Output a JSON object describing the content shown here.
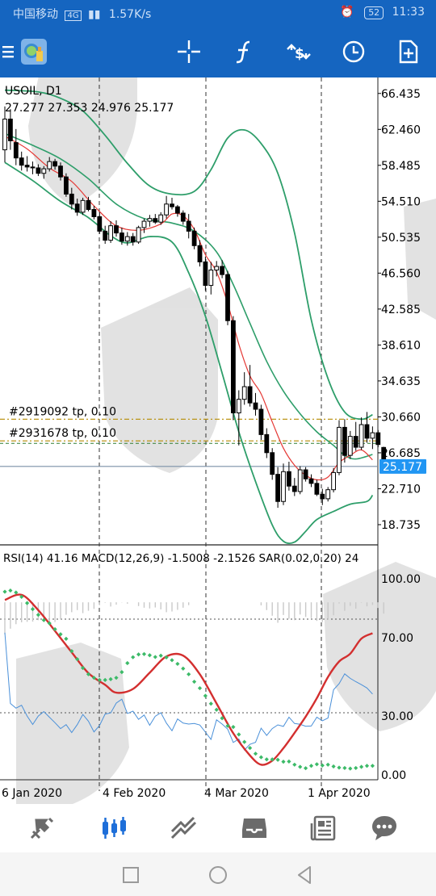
{
  "status_bar": {
    "carrier": "中国移动",
    "network": "4G",
    "speed": "1.57K/s",
    "battery": "52",
    "time": "11:33"
  },
  "toolbar": {
    "icons": [
      "menu-icon",
      "app-logo-icon",
      "crosshair-icon",
      "indicators-icon",
      "trade-icon",
      "timeframe-icon",
      "new-order-icon"
    ]
  },
  "chart": {
    "symbol_line": "USOIL, D1",
    "ohlc_line": "27.277 27.353 24.976 25.177",
    "current_price": "25.177",
    "price_labels": [
      "66.435",
      "62.460",
      "58.485",
      "54.510",
      "50.535",
      "46.560",
      "42.585",
      "38.610",
      "34.635",
      "30.660",
      "26.685",
      "22.710",
      "18.735"
    ],
    "order_lines": [
      {
        "label": "#2919092 tp, 0.10",
        "price": 30.4
      },
      {
        "label": "#2931678 tp, 0.10",
        "price": 28.0
      }
    ],
    "indicator_header": "RSI(14) 41.16 MACD(12,26,9) -1.5008 -2.1526 SAR(0.02,0.20) 24",
    "indicator_labels": [
      "100.00",
      "70.00",
      "30.00",
      "0.00"
    ],
    "date_labels": [
      "6 Jan 2020",
      "4 Feb 2020",
      "4 Mar 2020",
      "1 Apr 2020"
    ],
    "colors": {
      "bull_candle": "#ffffff",
      "bear_candle": "#000000",
      "bollinger": "#2e9e6a",
      "moving_average": "#e53935",
      "rsi": "#4a90d9",
      "macd_signal": "#d32f2f",
      "sar": "#3cba68",
      "current_price_tag": "#2196f3",
      "order_line": "#b58a00",
      "order_line_2": "#2e7d32"
    }
  },
  "chart_data": {
    "type": "candlestick",
    "symbol": "USOIL",
    "timeframe": "D1",
    "ylim": [
      16.5,
      68.2
    ],
    "date_ticks": [
      "6 Jan 2020",
      "4 Feb 2020",
      "4 Mar 2020",
      "1 Apr 2020"
    ],
    "candles": [
      {
        "o": 60.2,
        "h": 65.0,
        "l": 58.8,
        "c": 63.6
      },
      {
        "o": 63.6,
        "h": 64.7,
        "l": 60.2,
        "c": 61.2
      },
      {
        "o": 61.0,
        "h": 62.5,
        "l": 58.5,
        "c": 59.3
      },
      {
        "o": 59.3,
        "h": 60.0,
        "l": 57.9,
        "c": 58.5
      },
      {
        "o": 58.5,
        "h": 59.5,
        "l": 57.8,
        "c": 58.3
      },
      {
        "o": 58.3,
        "h": 58.9,
        "l": 57.5,
        "c": 58.2
      },
      {
        "o": 58.2,
        "h": 58.6,
        "l": 57.3,
        "c": 57.6
      },
      {
        "o": 57.6,
        "h": 58.4,
        "l": 57.0,
        "c": 58.1
      },
      {
        "o": 58.1,
        "h": 59.4,
        "l": 57.8,
        "c": 58.9
      },
      {
        "o": 58.9,
        "h": 59.2,
        "l": 58.0,
        "c": 58.4
      },
      {
        "o": 58.4,
        "h": 58.8,
        "l": 56.8,
        "c": 57.2
      },
      {
        "o": 57.2,
        "h": 57.6,
        "l": 55.0,
        "c": 55.3
      },
      {
        "o": 55.3,
        "h": 56.0,
        "l": 53.6,
        "c": 54.2
      },
      {
        "o": 54.2,
        "h": 54.8,
        "l": 52.9,
        "c": 53.3
      },
      {
        "o": 53.3,
        "h": 54.9,
        "l": 53.0,
        "c": 54.6
      },
      {
        "o": 54.6,
        "h": 55.0,
        "l": 53.4,
        "c": 53.6
      },
      {
        "o": 53.6,
        "h": 54.0,
        "l": 52.5,
        "c": 52.8
      },
      {
        "o": 52.8,
        "h": 53.3,
        "l": 50.9,
        "c": 51.2
      },
      {
        "o": 51.2,
        "h": 51.8,
        "l": 49.8,
        "c": 50.2
      },
      {
        "o": 50.2,
        "h": 52.3,
        "l": 49.9,
        "c": 51.8
      },
      {
        "o": 51.8,
        "h": 52.4,
        "l": 50.6,
        "c": 51.0
      },
      {
        "o": 51.0,
        "h": 51.6,
        "l": 49.7,
        "c": 50.1
      },
      {
        "o": 50.1,
        "h": 51.1,
        "l": 49.6,
        "c": 50.6
      },
      {
        "o": 50.6,
        "h": 51.0,
        "l": 49.6,
        "c": 50.0
      },
      {
        "o": 50.0,
        "h": 51.8,
        "l": 49.8,
        "c": 51.6
      },
      {
        "o": 51.6,
        "h": 52.6,
        "l": 51.0,
        "c": 52.3
      },
      {
        "o": 52.3,
        "h": 53.0,
        "l": 51.7,
        "c": 52.6
      },
      {
        "o": 52.6,
        "h": 53.1,
        "l": 52.0,
        "c": 52.2
      },
      {
        "o": 52.2,
        "h": 53.3,
        "l": 51.9,
        "c": 53.0
      },
      {
        "o": 53.0,
        "h": 55.1,
        "l": 52.6,
        "c": 54.2
      },
      {
        "o": 54.2,
        "h": 54.9,
        "l": 53.6,
        "c": 53.9
      },
      {
        "o": 53.9,
        "h": 54.1,
        "l": 52.8,
        "c": 53.2
      },
      {
        "o": 53.2,
        "h": 53.5,
        "l": 51.9,
        "c": 52.3
      },
      {
        "o": 52.3,
        "h": 53.1,
        "l": 50.4,
        "c": 51.2
      },
      {
        "o": 51.2,
        "h": 51.6,
        "l": 49.2,
        "c": 49.6
      },
      {
        "o": 49.6,
        "h": 50.2,
        "l": 47.3,
        "c": 47.8
      },
      {
        "o": 47.8,
        "h": 48.4,
        "l": 44.6,
        "c": 45.2
      },
      {
        "o": 45.2,
        "h": 47.8,
        "l": 44.2,
        "c": 46.9
      },
      {
        "o": 46.9,
        "h": 47.9,
        "l": 46.2,
        "c": 47.3
      },
      {
        "o": 47.3,
        "h": 48.0,
        "l": 46.0,
        "c": 46.4
      },
      {
        "o": 46.4,
        "h": 46.8,
        "l": 40.8,
        "c": 41.3
      },
      {
        "o": 41.3,
        "h": 41.8,
        "l": 30.3,
        "c": 31.1
      },
      {
        "o": 31.1,
        "h": 33.6,
        "l": 27.5,
        "c": 32.6
      },
      {
        "o": 32.6,
        "h": 35.6,
        "l": 32.0,
        "c": 34.0
      },
      {
        "o": 34.0,
        "h": 36.4,
        "l": 31.8,
        "c": 32.2
      },
      {
        "o": 32.2,
        "h": 33.3,
        "l": 30.8,
        "c": 31.5
      },
      {
        "o": 31.5,
        "h": 32.0,
        "l": 28.1,
        "c": 28.7
      },
      {
        "o": 28.7,
        "h": 29.4,
        "l": 26.1,
        "c": 26.7
      },
      {
        "o": 26.7,
        "h": 27.2,
        "l": 23.7,
        "c": 24.3
      },
      {
        "o": 24.3,
        "h": 25.1,
        "l": 20.6,
        "c": 21.3
      },
      {
        "o": 21.3,
        "h": 25.5,
        "l": 20.9,
        "c": 24.6
      },
      {
        "o": 24.6,
        "h": 25.7,
        "l": 22.5,
        "c": 23.0
      },
      {
        "o": 23.0,
        "h": 23.9,
        "l": 21.9,
        "c": 22.4
      },
      {
        "o": 22.4,
        "h": 25.2,
        "l": 22.1,
        "c": 24.8
      },
      {
        "o": 24.8,
        "h": 25.1,
        "l": 23.5,
        "c": 23.8
      },
      {
        "o": 23.8,
        "h": 24.3,
        "l": 22.9,
        "c": 23.3
      },
      {
        "o": 23.3,
        "h": 23.7,
        "l": 21.9,
        "c": 22.1
      },
      {
        "o": 22.1,
        "h": 22.7,
        "l": 20.9,
        "c": 21.6
      },
      {
        "o": 21.6,
        "h": 22.9,
        "l": 21.3,
        "c": 22.6
      },
      {
        "o": 22.6,
        "h": 25.0,
        "l": 22.3,
        "c": 24.5
      },
      {
        "o": 24.5,
        "h": 30.3,
        "l": 24.2,
        "c": 29.5
      },
      {
        "o": 29.5,
        "h": 30.4,
        "l": 25.6,
        "c": 26.4
      },
      {
        "o": 26.4,
        "h": 29.1,
        "l": 26.0,
        "c": 28.5
      },
      {
        "o": 28.5,
        "h": 30.1,
        "l": 26.9,
        "c": 27.3
      },
      {
        "o": 27.3,
        "h": 30.6,
        "l": 27.0,
        "c": 29.8
      },
      {
        "o": 29.8,
        "h": 31.2,
        "l": 27.8,
        "c": 28.3
      },
      {
        "o": 28.3,
        "h": 29.6,
        "l": 27.1,
        "c": 28.9
      },
      {
        "o": 28.9,
        "h": 29.2,
        "l": 27.3,
        "c": 27.6
      },
      {
        "o": 27.277,
        "h": 27.353,
        "l": 24.976,
        "c": 25.177
      }
    ],
    "bollinger_upper": [
      [
        0,
        66.8
      ],
      [
        6,
        66.6
      ],
      [
        10,
        65.9
      ],
      [
        14,
        64.5
      ],
      [
        18,
        61.8
      ],
      [
        22,
        58.7
      ],
      [
        26,
        56.2
      ],
      [
        30,
        55.3
      ],
      [
        34,
        55.6
      ],
      [
        37,
        58.0
      ],
      [
        40,
        61.5
      ],
      [
        43,
        62.4
      ],
      [
        46,
        60.9
      ],
      [
        49,
        57.6
      ],
      [
        52,
        51.0
      ],
      [
        55,
        41.4
      ],
      [
        58,
        34.9
      ],
      [
        61,
        31.2
      ],
      [
        64,
        30.4
      ],
      [
        66,
        30.9
      ]
    ],
    "bollinger_middle": [
      [
        0,
        62.0
      ],
      [
        5,
        60.7
      ],
      [
        10,
        59.2
      ],
      [
        15,
        57.0
      ],
      [
        20,
        54.2
      ],
      [
        25,
        52.6
      ],
      [
        30,
        52.1
      ],
      [
        34,
        51.2
      ],
      [
        38,
        48.9
      ],
      [
        41,
        45.3
      ],
      [
        44,
        41.0
      ],
      [
        47,
        36.8
      ],
      [
        50,
        33.5
      ],
      [
        53,
        31.0
      ],
      [
        56,
        29.0
      ],
      [
        59,
        27.5
      ],
      [
        61,
        26.4
      ],
      [
        63,
        26.0
      ],
      [
        66,
        26.5
      ]
    ],
    "bollinger_lower": [
      [
        0,
        58.8
      ],
      [
        5,
        56.8
      ],
      [
        10,
        54.5
      ],
      [
        15,
        52.7
      ],
      [
        19,
        50.7
      ],
      [
        22,
        49.9
      ],
      [
        26,
        50.6
      ],
      [
        30,
        50.0
      ],
      [
        33,
        46.6
      ],
      [
        36,
        41.8
      ],
      [
        39,
        35.5
      ],
      [
        42,
        29.0
      ],
      [
        45,
        23.5
      ],
      [
        48,
        18.7
      ],
      [
        50,
        16.9
      ],
      [
        52,
        16.8
      ],
      [
        54,
        18.0
      ],
      [
        56,
        19.3
      ],
      [
        59,
        20.2
      ],
      [
        62,
        21.0
      ],
      [
        65,
        21.3
      ],
      [
        66,
        22.0
      ]
    ],
    "moving_average": [
      [
        0,
        61.7
      ],
      [
        4,
        60.3
      ],
      [
        8,
        58.2
      ],
      [
        12,
        56.7
      ],
      [
        16,
        54.0
      ],
      [
        20,
        51.8
      ],
      [
        24,
        51.3
      ],
      [
        28,
        52.0
      ],
      [
        30,
        53.1
      ],
      [
        32,
        52.9
      ],
      [
        34,
        51.4
      ],
      [
        36,
        48.6
      ],
      [
        38,
        46.7
      ],
      [
        40,
        43.2
      ],
      [
        42,
        38.7
      ],
      [
        44,
        35.2
      ],
      [
        46,
        33.2
      ],
      [
        48,
        30.1
      ],
      [
        50,
        27.2
      ],
      [
        52,
        25.3
      ],
      [
        54,
        24.2
      ],
      [
        56,
        23.7
      ],
      [
        58,
        24.0
      ],
      [
        60,
        25.6
      ],
      [
        62,
        26.4
      ],
      [
        64,
        27.0
      ],
      [
        66,
        25.9
      ]
    ],
    "rsi": [
      [
        0,
        72.5
      ],
      [
        1,
        36.4
      ],
      [
        2,
        34.0
      ],
      [
        3,
        35.5
      ],
      [
        4,
        30.0
      ],
      [
        5,
        25.7
      ],
      [
        6,
        30.0
      ],
      [
        7,
        32.3
      ],
      [
        8,
        29.4
      ],
      [
        9,
        26.6
      ],
      [
        10,
        23.6
      ],
      [
        11,
        25.6
      ],
      [
        12,
        21.6
      ],
      [
        13,
        25.6
      ],
      [
        14,
        30.8
      ],
      [
        15,
        27.4
      ],
      [
        16,
        21.9
      ],
      [
        17,
        25.2
      ],
      [
        18,
        31.0
      ],
      [
        19,
        31.6
      ],
      [
        20,
        36.6
      ],
      [
        21,
        38.6
      ],
      [
        22,
        31.3
      ],
      [
        23,
        32.5
      ],
      [
        24,
        28.3
      ],
      [
        25,
        30.5
      ],
      [
        26,
        25.3
      ],
      [
        27,
        29.9
      ],
      [
        28,
        31.7
      ],
      [
        29,
        26.4
      ],
      [
        30,
        22.5
      ],
      [
        31,
        28.5
      ],
      [
        32,
        26.4
      ],
      [
        33,
        25.9
      ],
      [
        34,
        26.2
      ],
      [
        35,
        25.4
      ],
      [
        36,
        21.8
      ],
      [
        37,
        18.1
      ],
      [
        38,
        28.1
      ],
      [
        39,
        25.9
      ],
      [
        40,
        23.3
      ],
      [
        41,
        16.5
      ],
      [
        42,
        18.3
      ],
      [
        43,
        12.7
      ],
      [
        44,
        15.6
      ],
      [
        45,
        16.6
      ],
      [
        46,
        23.8
      ],
      [
        47,
        20.1
      ],
      [
        48,
        23.6
      ],
      [
        49,
        25.5
      ],
      [
        50,
        24.7
      ],
      [
        51,
        29.4
      ],
      [
        52,
        26.2
      ],
      [
        53,
        25.8
      ],
      [
        54,
        24.8
      ],
      [
        55,
        24.9
      ],
      [
        56,
        29.4
      ],
      [
        57,
        27.6
      ],
      [
        58,
        29.0
      ],
      [
        59,
        43.4
      ],
      [
        60,
        46.5
      ],
      [
        61,
        51.5
      ],
      [
        62,
        49.2
      ],
      [
        63,
        47.5
      ],
      [
        64,
        46.0
      ],
      [
        65,
        44.3
      ],
      [
        66,
        41.2
      ]
    ],
    "macd_signal": [
      [
        0,
        89.2
      ],
      [
        3,
        91.8
      ],
      [
        6,
        84.0
      ],
      [
        9,
        73.4
      ],
      [
        12,
        62.5
      ],
      [
        15,
        51.9
      ],
      [
        18,
        45.9
      ],
      [
        20,
        41.9
      ],
      [
        23,
        43.8
      ],
      [
        26,
        52.1
      ],
      [
        29,
        60.4
      ],
      [
        32,
        60.8
      ],
      [
        35,
        51.3
      ],
      [
        38,
        36.4
      ],
      [
        41,
        21.2
      ],
      [
        44,
        9.9
      ],
      [
        46,
        5.2
      ],
      [
        48,
        7.2
      ],
      [
        50,
        13.6
      ],
      [
        52,
        21.4
      ],
      [
        54,
        29.7
      ],
      [
        56,
        39.1
      ],
      [
        58,
        49.9
      ],
      [
        60,
        57.8
      ],
      [
        62,
        61.8
      ],
      [
        64,
        69.5
      ],
      [
        66,
        72.2
      ]
    ],
    "sar": [
      [
        0,
        93.4
      ],
      [
        1,
        94.0
      ],
      [
        2,
        93.0
      ],
      [
        3,
        90.8
      ],
      [
        4,
        87.6
      ],
      [
        5,
        84.5
      ],
      [
        6,
        81.6
      ],
      [
        7,
        78.9
      ],
      [
        8,
        77.3
      ],
      [
        9,
        74.3
      ],
      [
        10,
        71.7
      ],
      [
        11,
        69.4
      ],
      [
        12,
        63.1
      ],
      [
        13,
        59.0
      ],
      [
        14,
        54.5
      ],
      [
        15,
        51.3
      ],
      [
        16,
        49.5
      ],
      [
        17,
        48.4
      ],
      [
        18,
        48.4
      ],
      [
        19,
        48.8
      ],
      [
        20,
        49.5
      ],
      [
        21,
        52.4
      ],
      [
        22,
        57.0
      ],
      [
        23,
        60.0
      ],
      [
        24,
        61.4
      ],
      [
        25,
        61.6
      ],
      [
        26,
        61.0
      ],
      [
        27,
        60.1
      ],
      [
        28,
        60.8
      ],
      [
        29,
        59.9
      ],
      [
        30,
        58.5
      ],
      [
        31,
        56.6
      ],
      [
        32,
        54.2
      ],
      [
        33,
        51.3
      ],
      [
        34,
        47.5
      ],
      [
        35,
        44.2
      ],
      [
        36,
        40.3
      ],
      [
        37,
        36.3
      ],
      [
        38,
        33.2
      ],
      [
        39,
        28.9
      ],
      [
        40,
        25.0
      ],
      [
        41,
        24.4
      ],
      [
        42,
        20.6
      ],
      [
        43,
        16.8
      ],
      [
        44,
        13.7
      ],
      [
        45,
        10.8
      ],
      [
        46,
        9.0
      ],
      [
        47,
        7.9
      ],
      [
        48,
        7.9
      ],
      [
        49,
        7.7
      ],
      [
        50,
        6.7
      ],
      [
        51,
        6.8
      ],
      [
        52,
        5.2
      ],
      [
        53,
        4.1
      ],
      [
        54,
        3.4
      ],
      [
        55,
        4.6
      ],
      [
        56,
        5.4
      ],
      [
        57,
        4.8
      ],
      [
        58,
        5.2
      ],
      [
        59,
        4.3
      ],
      [
        60,
        3.7
      ],
      [
        61,
        3.5
      ],
      [
        62,
        3.2
      ],
      [
        63,
        3.5
      ],
      [
        64,
        4.1
      ],
      [
        65,
        4.6
      ],
      [
        66,
        4.6
      ]
    ],
    "indicator_ylim": [
      -2.5,
      114
    ]
  },
  "bottom_nav": {
    "items": [
      "quotes-icon",
      "chart-icon",
      "trade-icon",
      "history-icon",
      "news-icon",
      "chat-icon"
    ],
    "active": "chart-icon"
  },
  "system_nav": {
    "items": [
      "recents-icon",
      "home-icon",
      "back-icon"
    ]
  }
}
